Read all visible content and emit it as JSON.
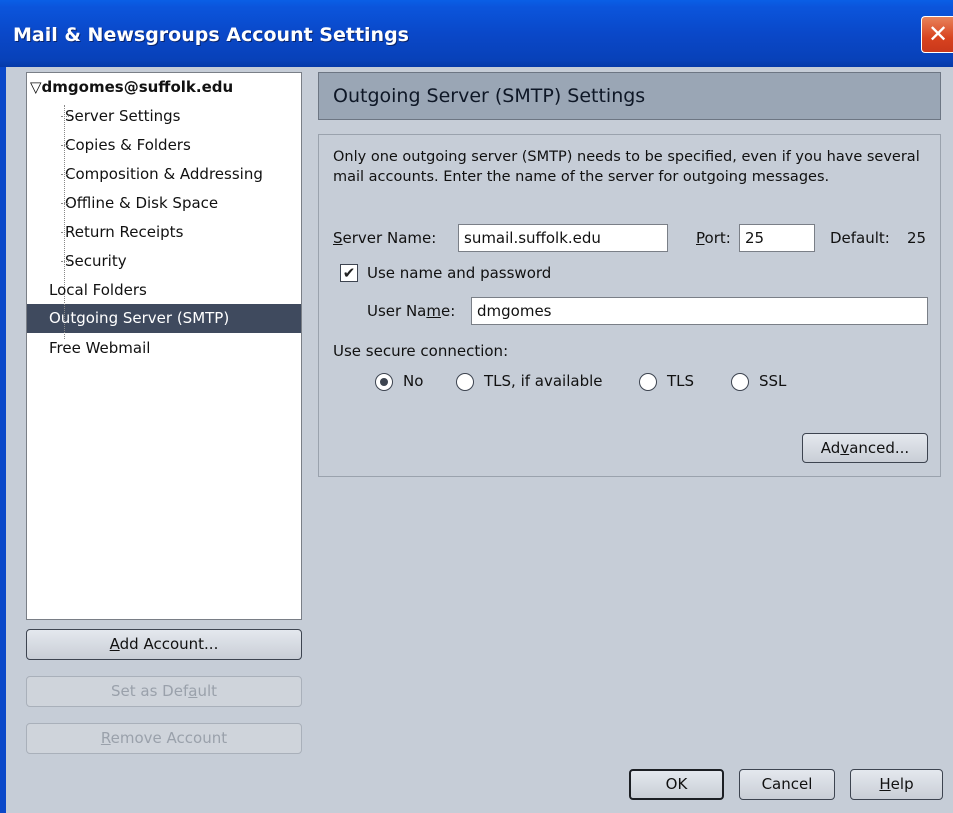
{
  "window": {
    "title": "Mail & Newsgroups Account Settings",
    "close_glyph": "✕"
  },
  "tree": {
    "account": {
      "arrow": "▽",
      "label": "dmgomes@suffolk.edu"
    },
    "children": [
      {
        "label": "Server Settings"
      },
      {
        "label": "Copies & Folders"
      },
      {
        "label": "Composition & Addressing"
      },
      {
        "label": "Offline & Disk Space"
      },
      {
        "label": "Return Receipts"
      },
      {
        "label": "Security"
      }
    ],
    "top_items": [
      {
        "label": "Local Folders"
      },
      {
        "label": "Outgoing Server (SMTP)",
        "selected": true
      },
      {
        "label": "Free Webmail"
      }
    ]
  },
  "left_buttons": {
    "add_account": {
      "pre": "",
      "key": "A",
      "post": "dd Account..."
    },
    "set_default": {
      "pre": "Set as Def",
      "key": "a",
      "post": "ult"
    },
    "remove_account": {
      "pre": "",
      "key": "R",
      "post": "emove Account"
    }
  },
  "header": {
    "title": "Outgoing Server (SMTP) Settings"
  },
  "panel": {
    "description": "Only one outgoing server (SMTP) needs to be specified, even if you have several mail accounts. Enter the name of the server for outgoing messages.",
    "server_name": {
      "key": "S",
      "rest": "erver Name:",
      "value": "sumail.suffolk.edu"
    },
    "port": {
      "key": "P",
      "rest": "ort:",
      "value": "25"
    },
    "default_label": "Default:",
    "default_value": "25",
    "use_name_password": {
      "label": "Use name and password",
      "checked": true,
      "check_glyph": "✔"
    },
    "user_name": {
      "pre": "User Na",
      "key": "m",
      "post": "e:",
      "value": "dmgomes"
    },
    "secure_label": "Use secure connection:",
    "secure_options": [
      {
        "label": "No",
        "selected": true
      },
      {
        "label": "TLS, if available",
        "selected": false
      },
      {
        "label": "TLS",
        "selected": false
      },
      {
        "label": "SSL",
        "selected": false
      }
    ],
    "advanced": {
      "pre": "Ad",
      "key": "v",
      "post": "anced..."
    }
  },
  "footer": {
    "ok": "OK",
    "cancel": "Cancel",
    "help": {
      "key": "H",
      "post": "elp"
    }
  },
  "colors": {
    "titlebar": "#0a48c9",
    "background": "#c6cdd7",
    "selection": "#3f4a5e",
    "header": "#9aa6b5"
  }
}
